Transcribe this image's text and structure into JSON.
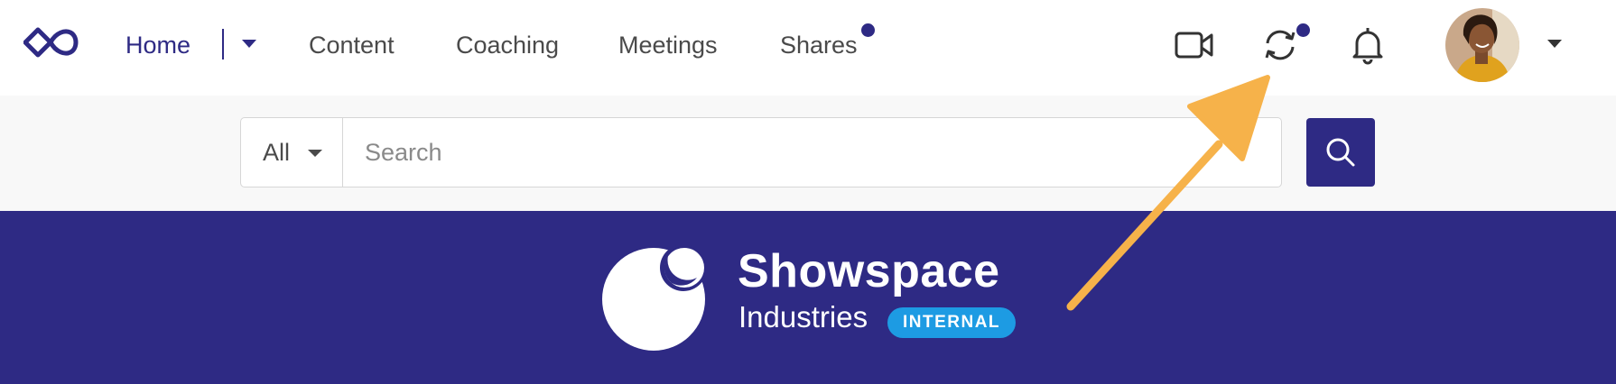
{
  "nav": {
    "items": [
      {
        "label": "Home"
      },
      {
        "label": "Content"
      },
      {
        "label": "Coaching"
      },
      {
        "label": "Meetings"
      },
      {
        "label": "Shares"
      }
    ],
    "icons": [
      "infinity-logo-icon",
      "video-camera-icon",
      "sync-icon",
      "bell-icon"
    ],
    "accent_color": "#2e2a84"
  },
  "search": {
    "scope": "All",
    "placeholder": "Search"
  },
  "banner": {
    "brand_name": "Showspace",
    "brand_sub": "Industries",
    "badge": "INTERNAL",
    "background_color": "#2e2a84",
    "badge_color": "#1d9be3"
  },
  "annotation": {
    "arrow_color": "#f6b24a",
    "points_to": "sync-icon"
  }
}
